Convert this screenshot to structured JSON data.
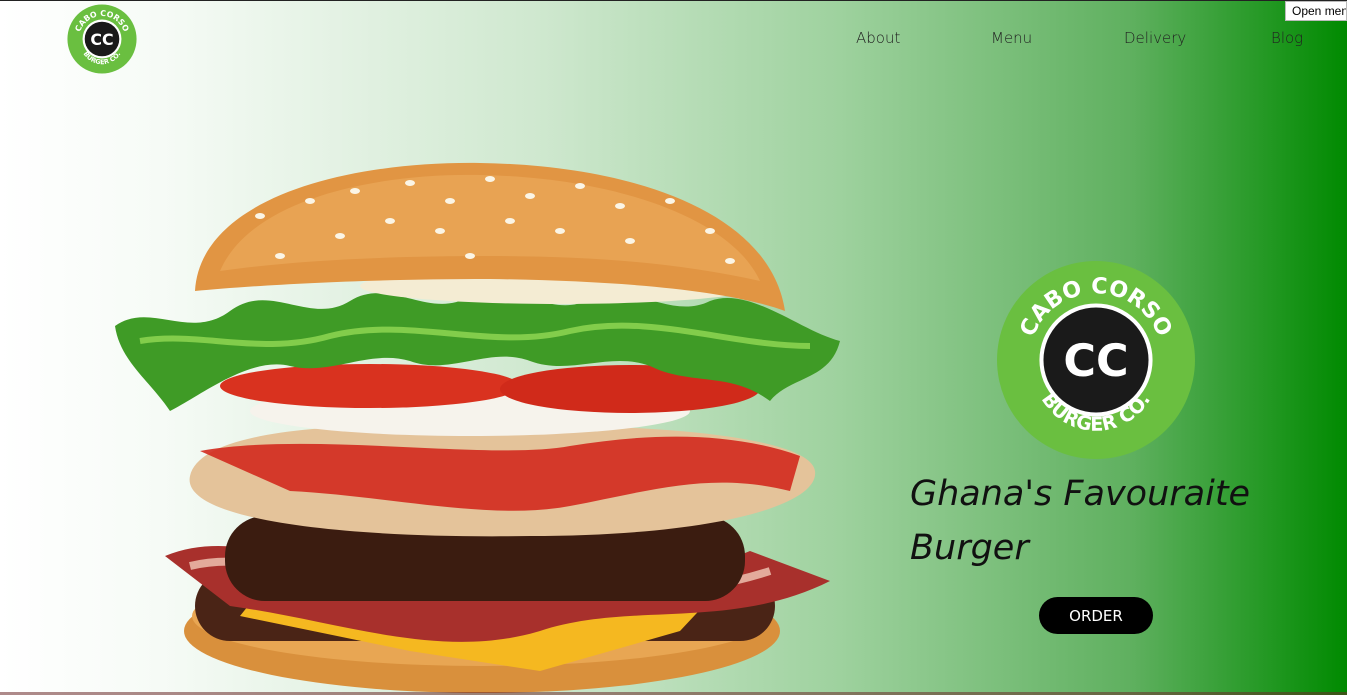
{
  "brand": {
    "logo_top_text": "CABO CORSO",
    "logo_initials": "CC",
    "logo_bottom_text": "BURGER CO.",
    "logo_green": "#6abf40"
  },
  "nav": {
    "items": [
      "About",
      "Menu",
      "Delivery",
      "Blog"
    ],
    "open_menu_label": "Open menu"
  },
  "hero": {
    "tagline": "Ghana's Favouraite Burger",
    "order_label": "ORDER",
    "image": "burger-photo"
  },
  "colors": {
    "gradient_start": "#ffffff",
    "gradient_end": "#008a00",
    "button_bg": "#000000"
  }
}
